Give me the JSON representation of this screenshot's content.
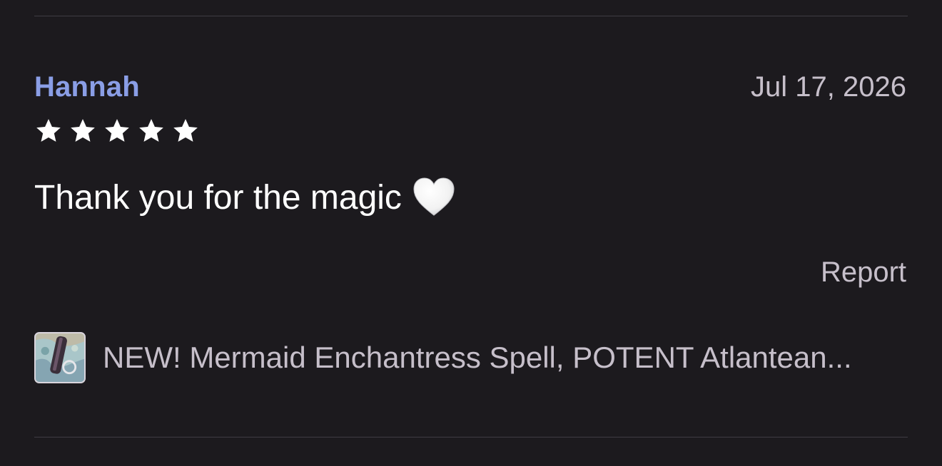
{
  "review": {
    "reviewer_name": "Hannah",
    "date": "Jul 17, 2026",
    "rating": 5,
    "max_rating": 5,
    "text": "Thank you for the magic",
    "emoji": "white-heart-icon",
    "report_label": "Report"
  },
  "listing": {
    "title": "NEW! Mermaid Enchantress Spell, POTENT Atlantean..."
  },
  "colors": {
    "background": "#1c1a1e",
    "reviewer_link": "#8a9ee6",
    "secondary_text": "#c6bfca",
    "primary_text": "#ffffff",
    "divider": "#3f3c44"
  }
}
